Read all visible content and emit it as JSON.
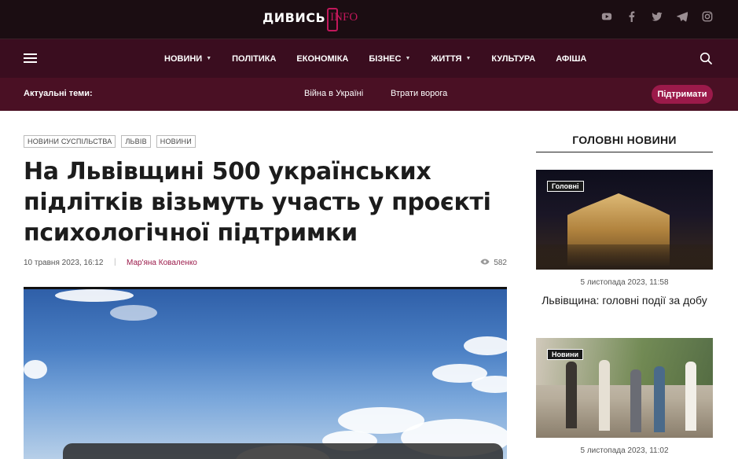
{
  "site": {
    "logo_main": "ДИВИСЬ",
    "logo_info": "INFO"
  },
  "socials": [
    "youtube-icon",
    "facebook-icon",
    "twitter-icon",
    "telegram-icon",
    "instagram-icon"
  ],
  "nav": {
    "items": [
      {
        "label": "НОВИНИ",
        "has_dropdown": true
      },
      {
        "label": "ПОЛІТИКА",
        "has_dropdown": false
      },
      {
        "label": "ЕКОНОМІКА",
        "has_dropdown": false
      },
      {
        "label": "БІЗНЕС",
        "has_dropdown": true
      },
      {
        "label": "ЖИТТЯ",
        "has_dropdown": true
      },
      {
        "label": "КУЛЬТУРА",
        "has_dropdown": false
      },
      {
        "label": "АФІША",
        "has_dropdown": false
      }
    ]
  },
  "topics": {
    "label": "Актуальні теми:",
    "links": [
      "Війна в Україні",
      "Втрати ворога"
    ],
    "support_label": "Підтримати"
  },
  "article": {
    "tags": [
      "НОВИНИ СУСПІЛЬСТВА",
      "ЛЬВІВ",
      "НОВИНИ"
    ],
    "title": "На Львівщині 500 українських підлітків візьмуть участь у проєкті психологічної підтримки",
    "date": "10 травня 2023, 16:12",
    "author": "Мар'яна Коваленко",
    "views": "582"
  },
  "sidebar": {
    "heading": "ГОЛОВНІ НОВИНИ",
    "cards": [
      {
        "badge": "Головні",
        "date": "5 листопада 2023, 11:58",
        "title": "Львівщина: головні події за добу"
      },
      {
        "badge": "Новини",
        "date": "5 листопада 2023, 11:02",
        "title": ""
      }
    ]
  },
  "colors": {
    "topbar": "#1b0d12",
    "navbar": "#3a0d1f",
    "topics_bar": "#4a1024",
    "accent": "#9b1a4a",
    "logo_accent": "#c2185b"
  }
}
